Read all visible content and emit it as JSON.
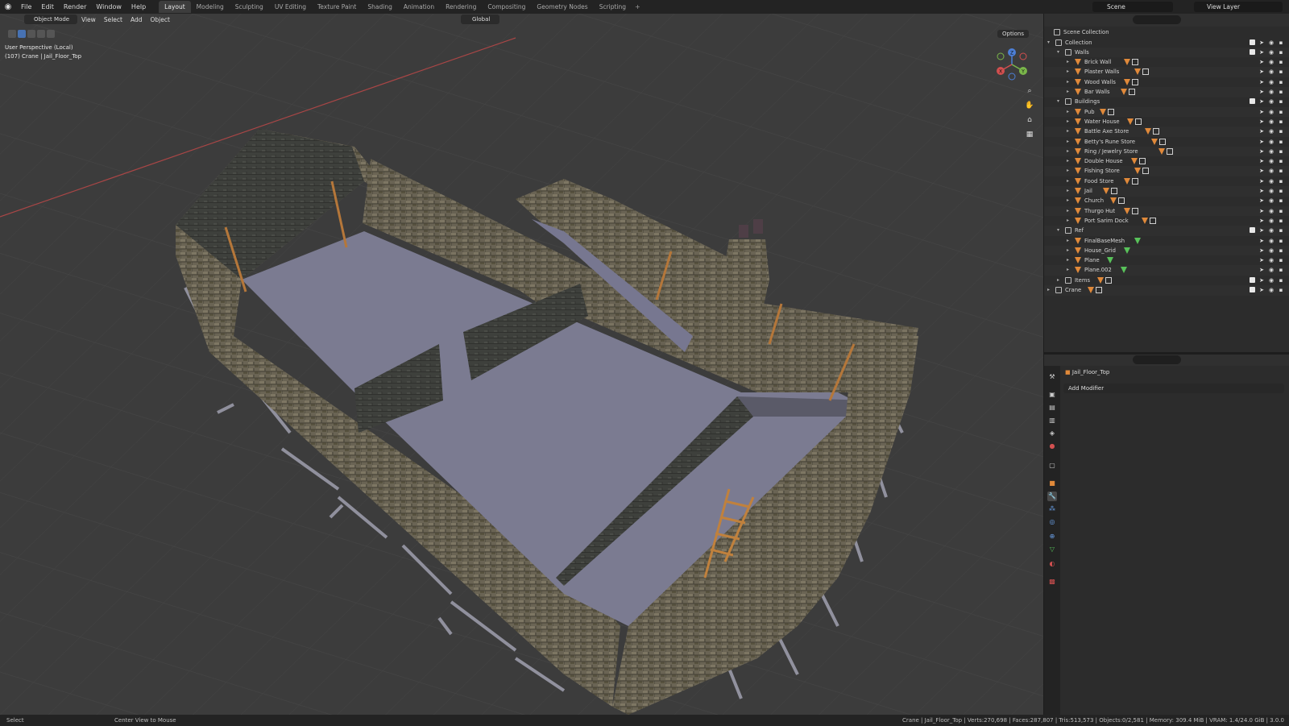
{
  "menubar": {
    "items": [
      "File",
      "Edit",
      "Render",
      "Window",
      "Help"
    ],
    "workspaces": [
      "Layout",
      "Modeling",
      "Sculpting",
      "UV Editing",
      "Texture Paint",
      "Shading",
      "Animation",
      "Rendering",
      "Compositing",
      "Geometry Nodes",
      "Scripting"
    ],
    "active_workspace": "Layout",
    "scene": "Scene",
    "view_layer": "View Layer"
  },
  "viewport": {
    "mode": "Object Mode",
    "menus": [
      "View",
      "Select",
      "Add",
      "Object"
    ],
    "orientation": "Global",
    "options": "Options",
    "info_line1": "User Perspective (Local)",
    "info_line2": "(107) Crane | Jail_Floor_Top",
    "gizmo": {
      "x": "X",
      "y": "Y",
      "z": "Z"
    }
  },
  "outliner": {
    "root": "Scene Collection",
    "rows": [
      {
        "label": "Collection",
        "type": "collection",
        "depth": 0,
        "expanded": true
      },
      {
        "label": "Walls",
        "type": "collection",
        "depth": 1,
        "expanded": true
      },
      {
        "label": "Brick Wall",
        "type": "object",
        "depth": 2
      },
      {
        "label": "Plaster Walls",
        "type": "object",
        "depth": 2
      },
      {
        "label": "Wood Walls",
        "type": "object",
        "depth": 2
      },
      {
        "label": "Bar Walls",
        "type": "object",
        "depth": 2
      },
      {
        "label": "Buildings",
        "type": "collection",
        "depth": 1,
        "expanded": true
      },
      {
        "label": "Pub",
        "type": "object",
        "depth": 2
      },
      {
        "label": "Water House",
        "type": "object",
        "depth": 2
      },
      {
        "label": "Battle Axe Store",
        "type": "object",
        "depth": 2
      },
      {
        "label": "Betty's Rune Store",
        "type": "object",
        "depth": 2
      },
      {
        "label": "Ring / Jewelry Store",
        "type": "object",
        "depth": 2
      },
      {
        "label": "Double House",
        "type": "object",
        "depth": 2
      },
      {
        "label": "Fishing Store",
        "type": "object",
        "depth": 2
      },
      {
        "label": "Food Store",
        "type": "object",
        "depth": 2
      },
      {
        "label": "Jail",
        "type": "object",
        "depth": 2
      },
      {
        "label": "Church",
        "type": "object",
        "depth": 2
      },
      {
        "label": "Thurgo Hut",
        "type": "object",
        "depth": 2
      },
      {
        "label": "Port Sarim Dock",
        "type": "object",
        "depth": 2
      },
      {
        "label": "Ref",
        "type": "collection",
        "depth": 1,
        "expanded": true
      },
      {
        "label": "FinalBaseMesh",
        "type": "mesh",
        "depth": 2
      },
      {
        "label": "House_Grid",
        "type": "mesh",
        "depth": 2
      },
      {
        "label": "Plane",
        "type": "mesh",
        "depth": 2
      },
      {
        "label": "Plane.002",
        "type": "mesh",
        "depth": 2
      },
      {
        "label": "Items",
        "type": "collection",
        "depth": 1,
        "expanded": false
      },
      {
        "label": "Crane",
        "type": "collection",
        "depth": 0,
        "expanded": false
      }
    ]
  },
  "properties": {
    "object_name": "Jail_Floor_Top",
    "add_modifier": "Add Modifier"
  },
  "statusbar": {
    "left": "Select",
    "middle": "Center View to Mouse",
    "right": "Crane | Jail_Floor_Top | Verts:270,698 | Faces:287,807 | Tris:513,573 | Objects:0/2,581 | Memory: 309.4 MiB | VRAM: 1.4/24.0 GiB | 3.0.0"
  },
  "colors": {
    "wall_stone": "#6b6556",
    "floor": "#7a7a90",
    "wood": "#b5773a",
    "viewport_bg": "#3c3c3c",
    "x_axis": "#c24b4b"
  }
}
